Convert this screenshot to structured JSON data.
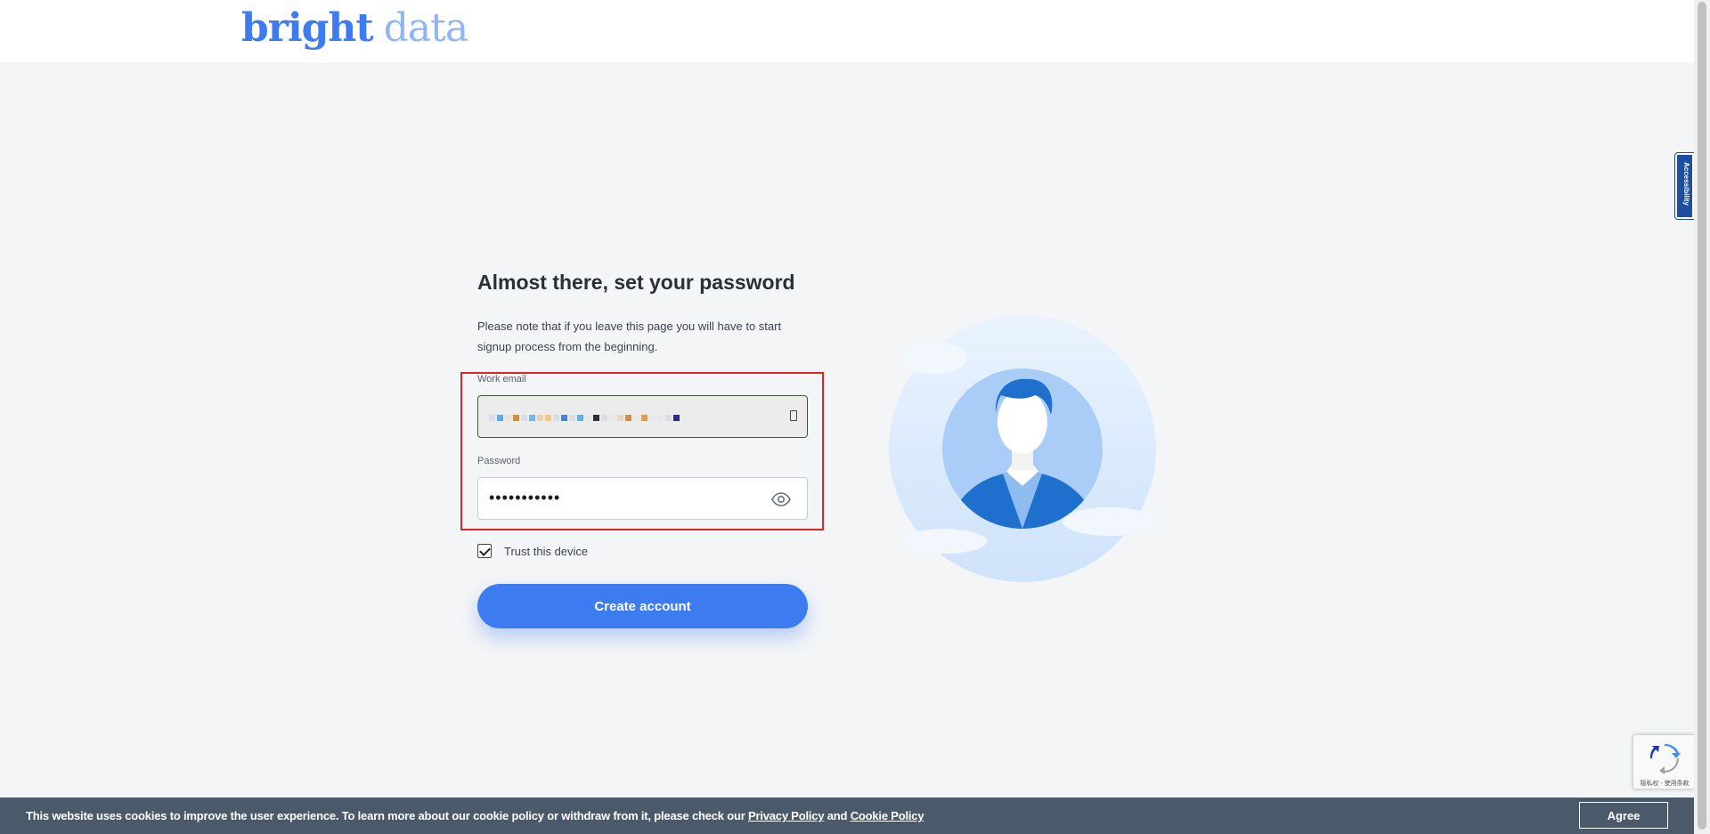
{
  "header": {
    "logo_part1": "bright",
    "logo_part2": "data"
  },
  "accessibility_tab": {
    "label": "Accessibility"
  },
  "form": {
    "title": "Almost there, set your password",
    "note": "Please note that if you leave this page you will have to start signup process from the beginning.",
    "email_label": "Work email",
    "password_label": "Password",
    "password_value": "•••••••••••",
    "trust_label": "Trust this device",
    "trust_checked": true,
    "submit_label": "Create account"
  },
  "recaptcha": {
    "footer": "隐私权 - 使用条款"
  },
  "cookie_bar": {
    "text": "This website uses cookies to improve the user experience. To learn more about our cookie policy or withdraw from it, please check our",
    "privacy_link": "Privacy Policy",
    "and": "and",
    "cookie_link": "Cookie Policy",
    "agree_label": "Agree"
  },
  "colors": {
    "accent": "#3d7cf0",
    "highlight_border": "#e5202a",
    "cookie_bar": "#4a5a6a"
  }
}
